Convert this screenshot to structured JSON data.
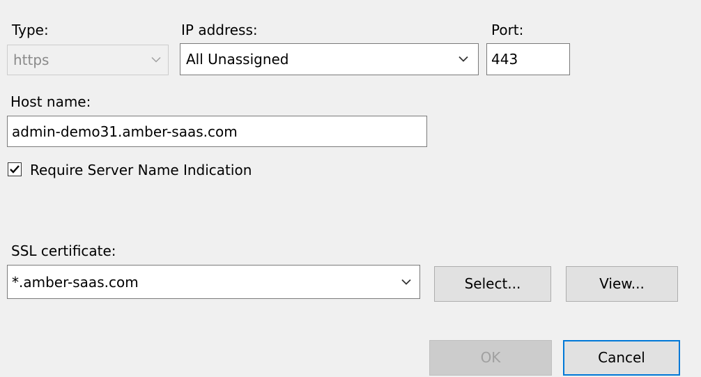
{
  "type": {
    "label": "Type:",
    "value": "https"
  },
  "ip_address": {
    "label": "IP address:",
    "value": "All Unassigned"
  },
  "port": {
    "label": "Port:",
    "value": "443"
  },
  "host_name": {
    "label": "Host name:",
    "value": "admin-demo31.amber-saas.com"
  },
  "sni": {
    "label": "Require Server Name Indication",
    "checked": true
  },
  "ssl_certificate": {
    "label": "SSL certificate:",
    "value": "*.amber-saas.com"
  },
  "buttons": {
    "select": "Select...",
    "view": "View...",
    "ok": "OK",
    "cancel": "Cancel"
  },
  "icons": {
    "dropdown": "chevron-down-icon",
    "check": "checkmark-icon"
  },
  "colors": {
    "background": "#f0f0f0",
    "focus_border": "#0078d7",
    "disabled_text": "#8a8a8a"
  }
}
